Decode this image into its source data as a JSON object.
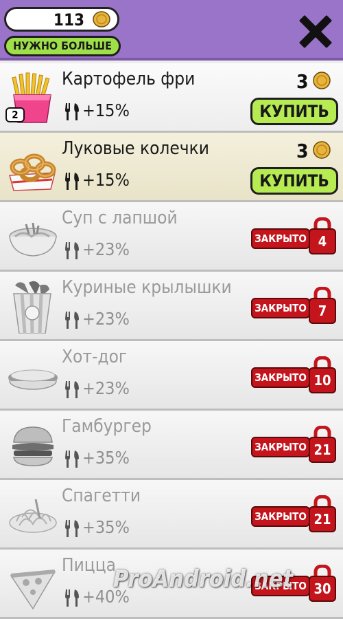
{
  "header": {
    "coins": "113",
    "need_more_label": "НУЖНО БОЛЬШЕ",
    "close_icon": "close-x-icon",
    "coin_icon": "coin-icon"
  },
  "items": [
    {
      "name": "Картофель фри",
      "bonus": "+15%",
      "state": "buy",
      "price": "3",
      "buy_label": "КУПИТЬ",
      "owned": "2",
      "icon": "fries-icon"
    },
    {
      "name": "Луковые колечки",
      "bonus": "+15%",
      "state": "buy",
      "price": "3",
      "buy_label": "КУПИТЬ",
      "icon": "onion-rings-icon"
    },
    {
      "name": "Суп с лапшой",
      "bonus": "+23%",
      "state": "locked",
      "locked_label": "ЗАКРЫТО",
      "level": "4",
      "icon": "noodle-soup-icon"
    },
    {
      "name": "Куриные крылышки",
      "bonus": "+23%",
      "state": "locked",
      "locked_label": "ЗАКРЫТО",
      "level": "7",
      "icon": "chicken-wings-icon"
    },
    {
      "name": "Хот-дог",
      "bonus": "+23%",
      "state": "locked",
      "locked_label": "ЗАКРЫТО",
      "level": "10",
      "icon": "hot-dog-icon"
    },
    {
      "name": "Гамбургер",
      "bonus": "+35%",
      "state": "locked",
      "locked_label": "ЗАКРЫТО",
      "level": "21",
      "icon": "hamburger-icon"
    },
    {
      "name": "Спагетти",
      "bonus": "+35%",
      "state": "locked",
      "locked_label": "ЗАКРЫТО",
      "level": "21",
      "icon": "spaghetti-icon"
    },
    {
      "name": "Пицца",
      "bonus": "+40%",
      "state": "locked",
      "locked_label": "ЗАКРЫТО",
      "level": "30",
      "icon": "pizza-icon"
    }
  ],
  "watermark": "ProAndroid.net",
  "colors": {
    "header": "#9a74c8",
    "buy_button": "#b6ec52",
    "locked": "#c4141c",
    "coin": "#e8b53a"
  }
}
